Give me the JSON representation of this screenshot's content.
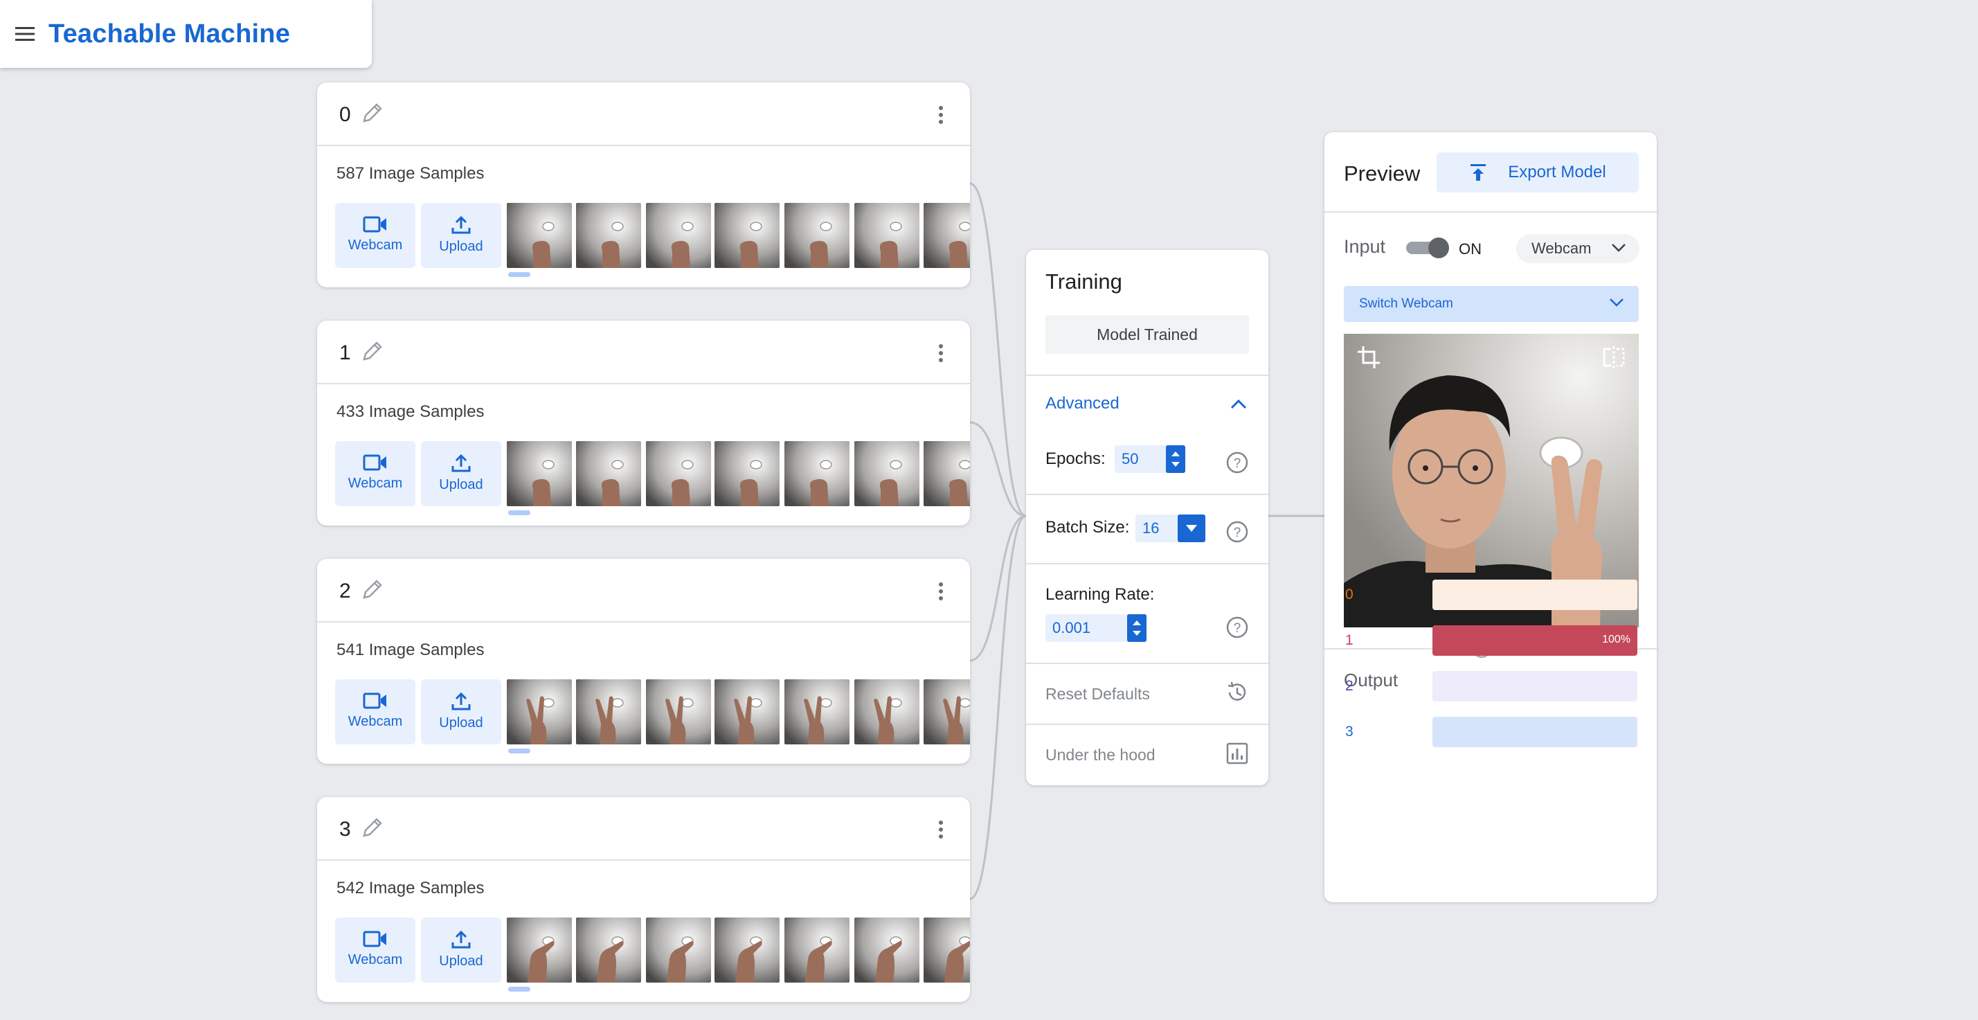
{
  "app": {
    "title": "Teachable Machine"
  },
  "classes": [
    {
      "name": "0",
      "samples": "587 Image Samples",
      "webcam_label": "Webcam",
      "upload_label": "Upload",
      "gesture": "fist"
    },
    {
      "name": "1",
      "samples": "433 Image Samples",
      "webcam_label": "Webcam",
      "upload_label": "Upload",
      "gesture": "fist"
    },
    {
      "name": "2",
      "samples": "541 Image Samples",
      "webcam_label": "Webcam",
      "upload_label": "Upload",
      "gesture": "peace"
    },
    {
      "name": "3",
      "samples": "542 Image Samples",
      "webcam_label": "Webcam",
      "upload_label": "Upload",
      "gesture": "point"
    }
  ],
  "training": {
    "title": "Training",
    "train_button": "Model Trained",
    "advanced_label": "Advanced",
    "epochs_label": "Epochs:",
    "epochs_value": "50",
    "batch_label": "Batch Size:",
    "batch_value": "16",
    "lr_label": "Learning Rate:",
    "lr_value": "0.001",
    "reset_label": "Reset Defaults",
    "hood_label": "Under the hood"
  },
  "preview": {
    "title": "Preview",
    "export_label": "Export Model",
    "input_label": "Input",
    "toggle_state": "ON",
    "source_selected": "Webcam",
    "switch_webcam": "Switch Webcam",
    "output_label": "Output",
    "outputs": [
      {
        "name": "0",
        "color": "#e8710a",
        "bg": "#fdeee3",
        "fraction": 0,
        "pct": ""
      },
      {
        "name": "1",
        "color": "#c5475a",
        "bg": "#f6dde1",
        "fraction": 1.0,
        "pct": "100%"
      },
      {
        "name": "2",
        "color": "#5145b5",
        "bg": "#eeecfb",
        "fraction": 0,
        "pct": ""
      },
      {
        "name": "3",
        "color": "#1967d2",
        "bg": "#d6e4fb",
        "fraction": 0,
        "pct": ""
      }
    ]
  },
  "colors": {
    "accent": "#1967d2",
    "background": "#e8eaed"
  }
}
